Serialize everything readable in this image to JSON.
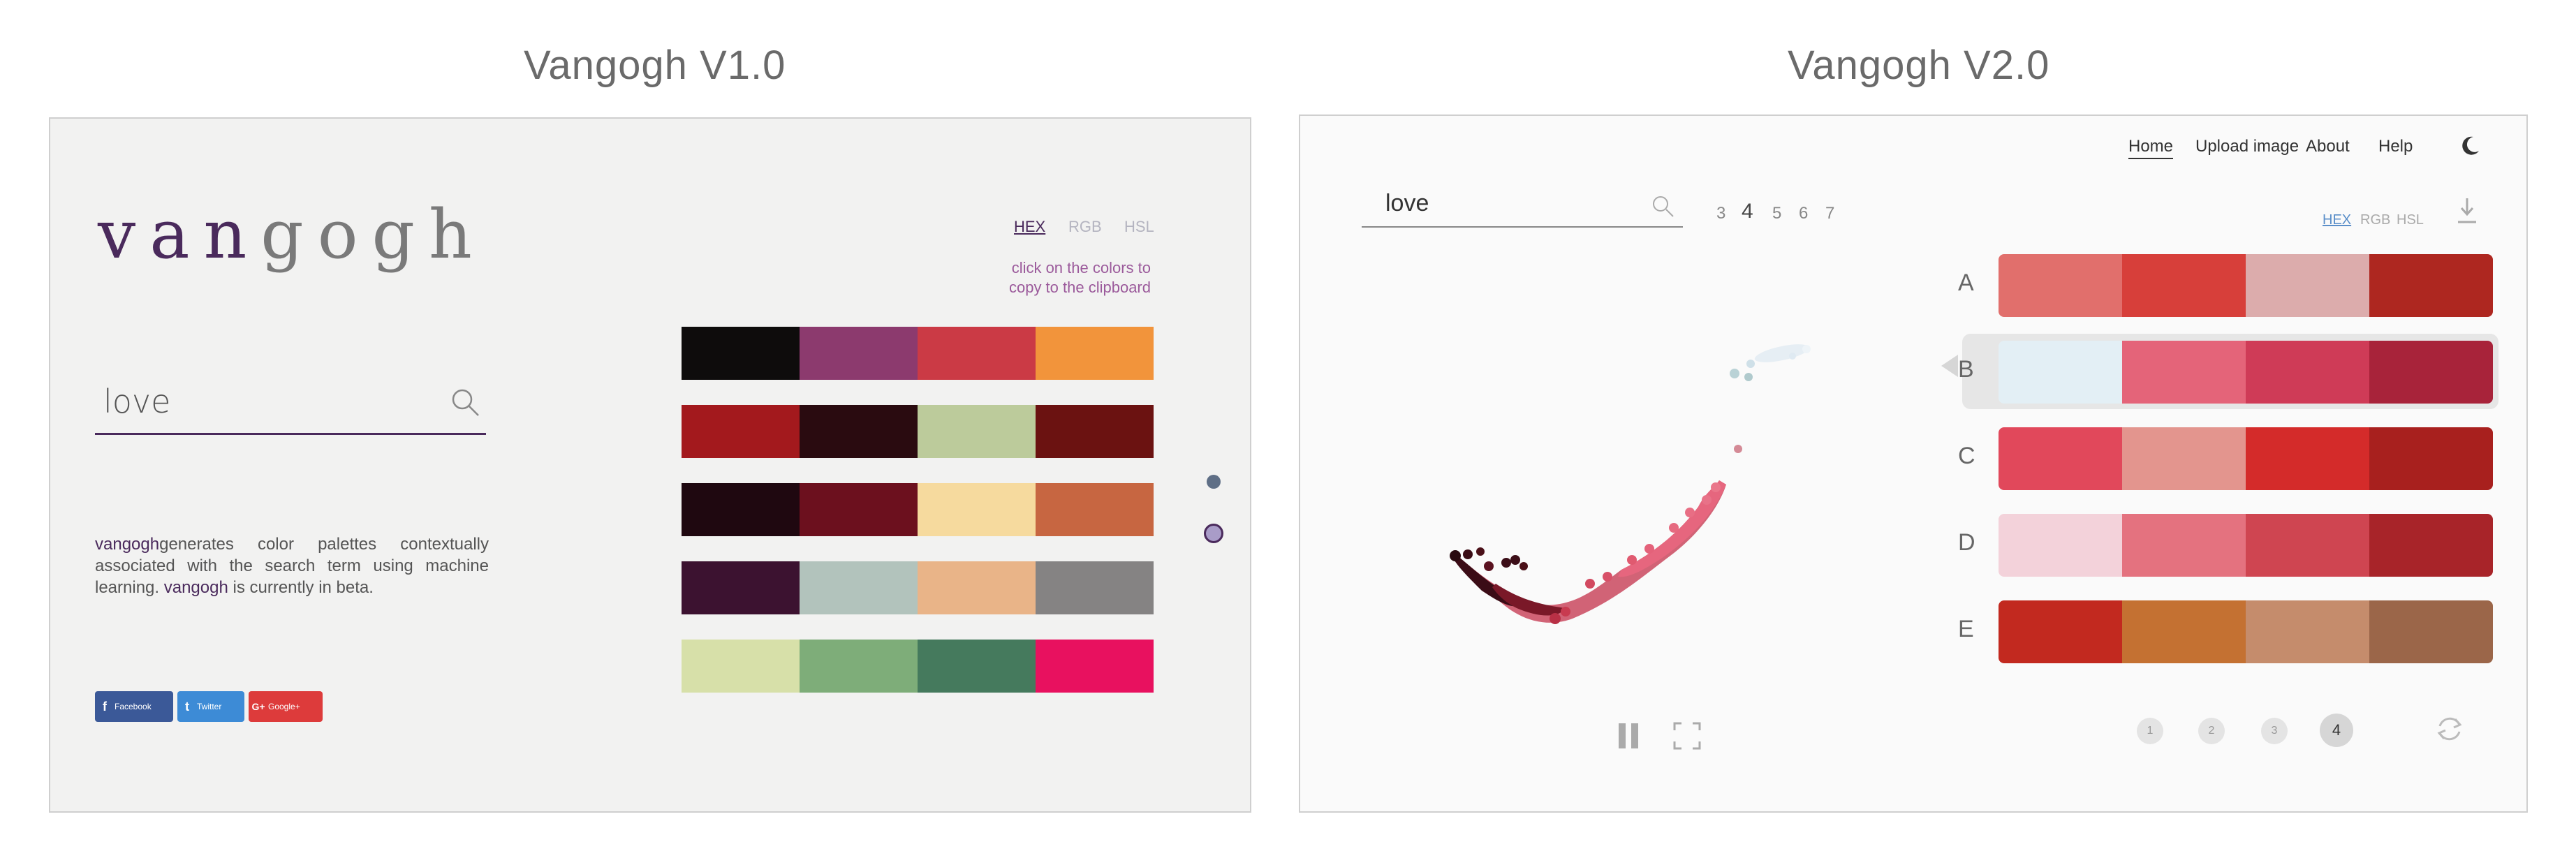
{
  "v1": {
    "section_title": "Vangogh V1.0",
    "logo_part1": "van",
    "logo_part2": "gogh",
    "search_value": "love",
    "desc_brand1": "vangogh",
    "desc_text1": "generates color palettes contextually associated with the search term using machine learning. ",
    "desc_brand2": "vangogh",
    "desc_text2": " is currently in beta.",
    "formats": [
      "HEX",
      "RGB",
      "HSL"
    ],
    "hint_line1": "click on the colors to",
    "hint_line2": "copy to the clipboard",
    "social": [
      {
        "icon": "f",
        "label": "Facebook",
        "color": "#3b5998"
      },
      {
        "icon": "t",
        "label": "Twitter",
        "color": "#3d8bd6"
      },
      {
        "icon": "G+",
        "label": "Google+",
        "color": "#dd3b3b"
      }
    ],
    "palettes": [
      [
        "#0e0c0c",
        "#8c3a6e",
        "#cb3a45",
        "#f2943b"
      ],
      [
        "#a3191d",
        "#2a0b10",
        "#bccb9b",
        "#6b1211"
      ],
      [
        "#1f0810",
        "#6c101e",
        "#f6da9e",
        "#c76641"
      ],
      [
        "#3c1230",
        "#b2c3bc",
        "#e9b488",
        "#858383"
      ],
      [
        "#d7e0a9",
        "#7ead79",
        "#457a5d",
        "#e8115f"
      ]
    ]
  },
  "v2": {
    "section_title": "Vangogh V2.0",
    "nav": [
      "Home",
      "Upload image",
      "About",
      "Help"
    ],
    "search_value": "love",
    "counts": [
      "3",
      "4",
      "5",
      "6",
      "7"
    ],
    "active_count": "4",
    "formats": [
      "HEX",
      "RGB",
      "HSL"
    ],
    "palettes": [
      {
        "label": "A",
        "colors": [
          "#e16f6c",
          "#d73f3a",
          "#dcacac",
          "#ae2720"
        ]
      },
      {
        "label": "B",
        "colors": [
          "#e3eff5",
          "#e46479",
          "#cf3b57",
          "#a8233a"
        ]
      },
      {
        "label": "C",
        "colors": [
          "#e1485b",
          "#e3958e",
          "#d42b2a",
          "#a8201e"
        ]
      },
      {
        "label": "D",
        "colors": [
          "#f3d2da",
          "#e4727f",
          "#cf4551",
          "#a82429"
        ]
      },
      {
        "label": "E",
        "colors": [
          "#c2291f",
          "#c47132",
          "#c58c6c",
          "#9b6649"
        ]
      }
    ],
    "selected_palette": "B",
    "pages": [
      "1",
      "2",
      "3",
      "4"
    ],
    "active_page": "4"
  }
}
